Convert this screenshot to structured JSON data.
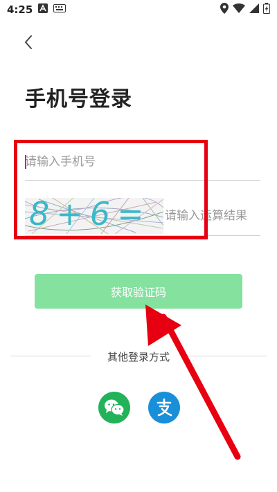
{
  "status_bar": {
    "time": "4:25"
  },
  "header": {
    "title": "手机号登录"
  },
  "form": {
    "phone_placeholder": "请输入手机号",
    "captcha_text": "8+6=",
    "captcha_placeholder": "请输入运算结果",
    "submit_label": "获取验证码"
  },
  "other_login": {
    "label": "其他登录方式"
  },
  "colors": {
    "primary_button": "#84e19e",
    "wechat": "#22b35a",
    "alipay": "#1a8fd9",
    "annotation_red": "#e60012"
  }
}
